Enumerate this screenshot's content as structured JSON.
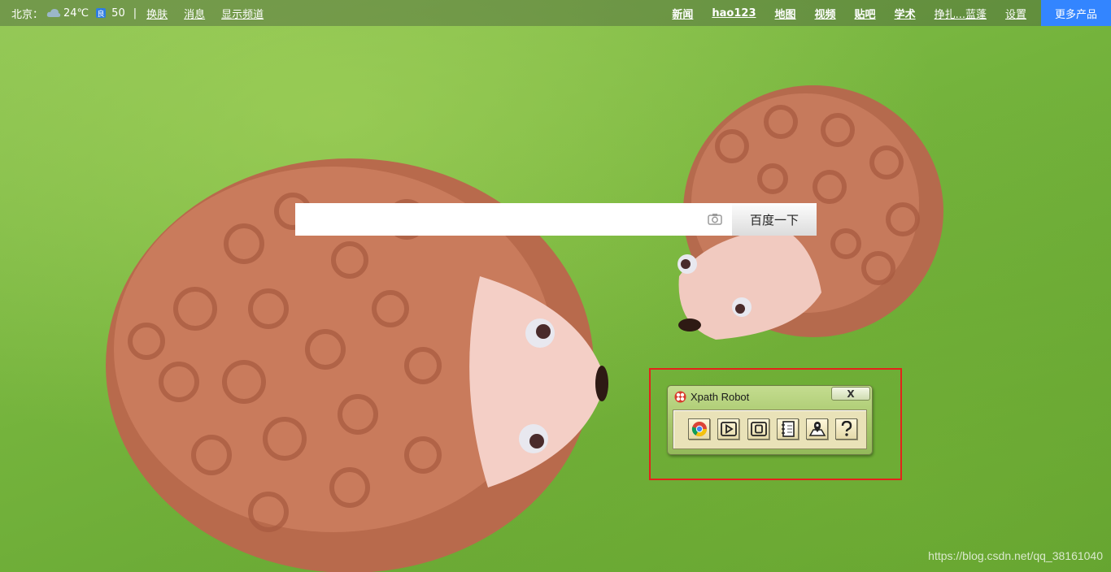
{
  "topbar": {
    "city": "北京：",
    "temperature": "24℃",
    "air_quality": "50",
    "separator": "|",
    "left_links": [
      "换肤",
      "消息",
      "显示频道"
    ],
    "right_links": [
      "新闻",
      "hao123",
      "地图",
      "视频",
      "贴吧",
      "学术",
      "挣扎...蓝蓬",
      "设置"
    ],
    "more_products": "更多产品"
  },
  "search": {
    "placeholder": "",
    "value": "",
    "button_label": "百度一下"
  },
  "xpath_robot": {
    "title": "Xpath Robot",
    "close_label": "X",
    "tools": [
      "chrome-icon",
      "play-icon",
      "stop-icon",
      "notebook-icon",
      "map-pin-icon",
      "help-icon"
    ]
  },
  "watermark": "https://blog.csdn.net/qq_38161040",
  "colors": {
    "accent": "#3385ff",
    "highlight": "#e3231b",
    "grass": "#74b33c",
    "yarn": "#c8775a"
  }
}
